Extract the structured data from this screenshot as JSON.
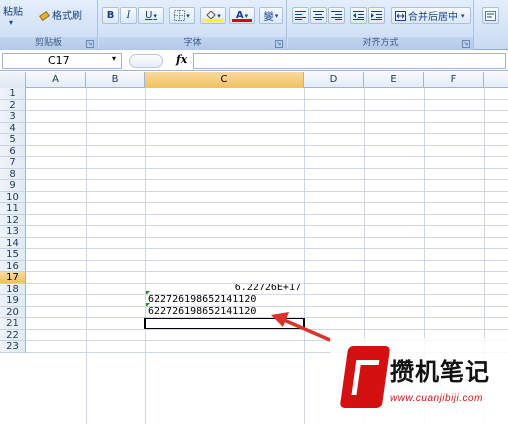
{
  "ribbon": {
    "clipboard": {
      "paste_label": "粘贴",
      "paste_arrow": "▾",
      "format_painter_label": "格式刷",
      "group_title": "剪贴板"
    },
    "font": {
      "bold_label": "B",
      "italic_label": "I",
      "underline_label": "U",
      "font_color_label": "A",
      "phonetic_label": "變",
      "group_title": "字体"
    },
    "alignment": {
      "merge_center_label": "合并后居中",
      "group_title": "对齐方式"
    },
    "launcher_glyph": "↘"
  },
  "formula_bar": {
    "name_box": "C17",
    "name_box_arrow": "▾",
    "fx_label": "fx",
    "formula": ""
  },
  "sheet": {
    "columns": [
      "A",
      "B",
      "C",
      "D",
      "E",
      "F"
    ],
    "active_column": "C",
    "rows": [
      "1",
      "2",
      "3",
      "4",
      "5",
      "6",
      "7",
      "8",
      "9",
      "10",
      "11",
      "12",
      "13",
      "14",
      "15",
      "16",
      "17",
      "18",
      "19",
      "20",
      "21",
      "22",
      "23"
    ],
    "active_row": "17",
    "cells": {
      "C14": "6.22726E+17",
      "C15": "622726198652141120",
      "C16": "622726198652141120"
    },
    "selected_cell": "C17"
  },
  "colors": {
    "arrow": "#d9332b",
    "selection": "#000000",
    "error_indicator": "#1e8a1e",
    "watermark_red": "#d41111"
  },
  "watermark": {
    "title": "攒机笔记",
    "url": "www.cuanjibiji.com"
  }
}
